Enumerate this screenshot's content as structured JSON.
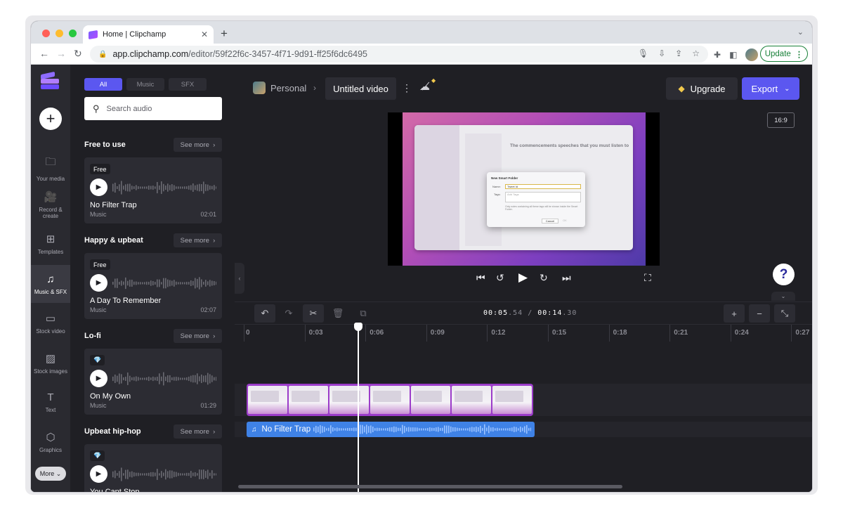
{
  "browser": {
    "tab_title": "Home | Clipchamp",
    "tab_close": "✕",
    "new_tab": "+",
    "url_host": "app.clipchamp.com",
    "url_path": "/editor/59f22f6c-3457-4f71-9d91-ff25f6dc6495",
    "update_label": "Update",
    "traffic_colors": [
      "#ff5f57",
      "#febc2e",
      "#28c840"
    ]
  },
  "rail": {
    "items": [
      {
        "label": "Your media",
        "icon": "folder-icon",
        "glyph": "🗀"
      },
      {
        "label": "Record & create",
        "icon": "camera-icon",
        "glyph": "🎥"
      },
      {
        "label": "Templates",
        "icon": "templates-icon",
        "glyph": "⊞"
      },
      {
        "label": "Music & SFX",
        "icon": "music-icon",
        "glyph": "♫"
      },
      {
        "label": "Stock video",
        "icon": "film-icon",
        "glyph": "▭"
      },
      {
        "label": "Stock images",
        "icon": "image-icon",
        "glyph": "▨"
      },
      {
        "label": "Text",
        "icon": "text-icon",
        "glyph": "T"
      },
      {
        "label": "Graphics",
        "icon": "shapes-icon",
        "glyph": "⬡"
      }
    ],
    "active": "Music & SFX",
    "more_label": "More"
  },
  "library": {
    "tabs": [
      "All",
      "Music",
      "SFX"
    ],
    "active_tab": "All",
    "search_placeholder": "Search audio",
    "see_more": "See more",
    "sections": [
      {
        "title": "Free to use",
        "card": {
          "badge": "Free",
          "title": "No Filter Trap",
          "type": "Music",
          "duration": "02:01"
        }
      },
      {
        "title": "Happy & upbeat",
        "card": {
          "badge": "Free",
          "title": "A Day To Remember",
          "type": "Music",
          "duration": "02:07"
        }
      },
      {
        "title": "Lo-fi",
        "card": {
          "badge": "💎",
          "title": "On My Own",
          "type": "Music",
          "duration": "01:29"
        }
      },
      {
        "title": "Upbeat hip-hop",
        "card": {
          "badge": "💎",
          "title": "You Cant Stop",
          "type": "",
          "duration": ""
        }
      }
    ]
  },
  "topbar": {
    "workspace": "Personal",
    "separator": "›",
    "project_name": "Untitled video",
    "menu_glyph": "⋮",
    "upgrade_label": "Upgrade",
    "export_label": "Export"
  },
  "preview": {
    "aspect_ratio": "16:9",
    "finder_title": "The commencements speeches that you must listen to",
    "dialog": {
      "title": "New Smart Folder",
      "name_label": "Name:",
      "name_value": "Tweet Id",
      "tags_label": "Tags:",
      "tags_placeholder": "Add Tags",
      "note": "Only notes containing all these tags will be shown inside the Smart Folder.",
      "cancel": "Cancel",
      "ok": "OK"
    },
    "help_label": "?"
  },
  "timeline": {
    "current_time": "00:05",
    "current_frac": ".54",
    "separator": "/",
    "total_time": "00:14",
    "total_frac": ".30",
    "ruler_labels": [
      "0",
      "0:03",
      "0:06",
      "0:09",
      "0:12",
      "0:15",
      "0:18",
      "0:21",
      "0:24",
      "0:27"
    ],
    "audio_clip_title": "No Filter Trap"
  }
}
